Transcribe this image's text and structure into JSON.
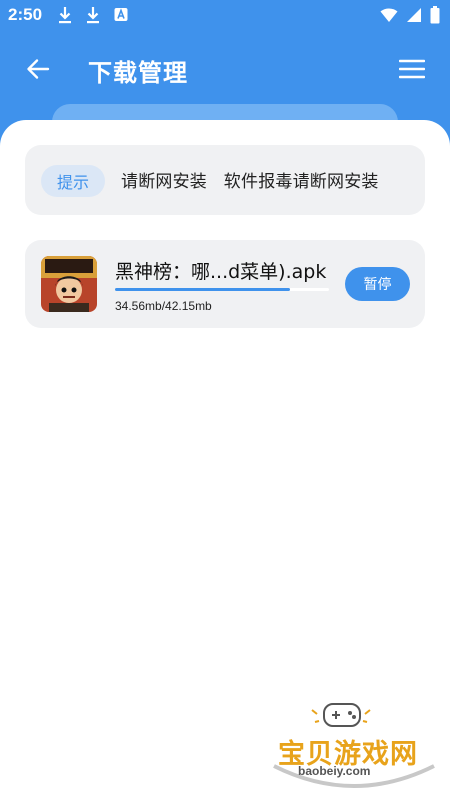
{
  "status_bar": {
    "time": "2:50",
    "left_icons": [
      "download-icon",
      "download-icon",
      "a-badge-icon"
    ],
    "right_icons": [
      "wifi-icon",
      "signal-icon",
      "battery-icon"
    ]
  },
  "header": {
    "title": "下载管理",
    "back_icon": "arrow-left-icon",
    "menu_icon": "menu-icon"
  },
  "notice": {
    "tag": "提示",
    "text": "请断网安装   软件报毒请断网安装"
  },
  "download": {
    "file_name": "黑神榜：哪...d菜单).apk",
    "progress": 0.82,
    "size_text": "34.56mb/42.15mb",
    "button_label": "暂停"
  },
  "watermark": {
    "brand": "宝贝游戏网",
    "url": "baobeiy.com"
  },
  "colors": {
    "primary": "#3f92ec",
    "card_bg": "#f0f1f3",
    "tag_bg": "#dbe7f6",
    "watermark": "#e8a31b"
  }
}
